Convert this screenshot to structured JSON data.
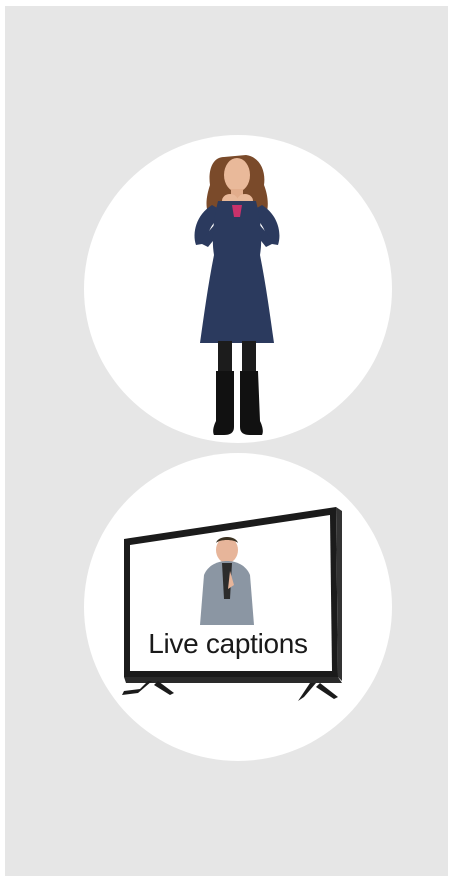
{
  "illustrations": {
    "top": {
      "icon": "sign-language-interpreter-icon"
    },
    "bottom": {
      "icon": "tv-icon",
      "caption_text": "Live captions"
    }
  },
  "colors": {
    "panel_background": "#e6e6e6",
    "circle_background": "#ffffff",
    "dress": "#2b3a5e",
    "tv_frame": "#1b1b1b"
  }
}
